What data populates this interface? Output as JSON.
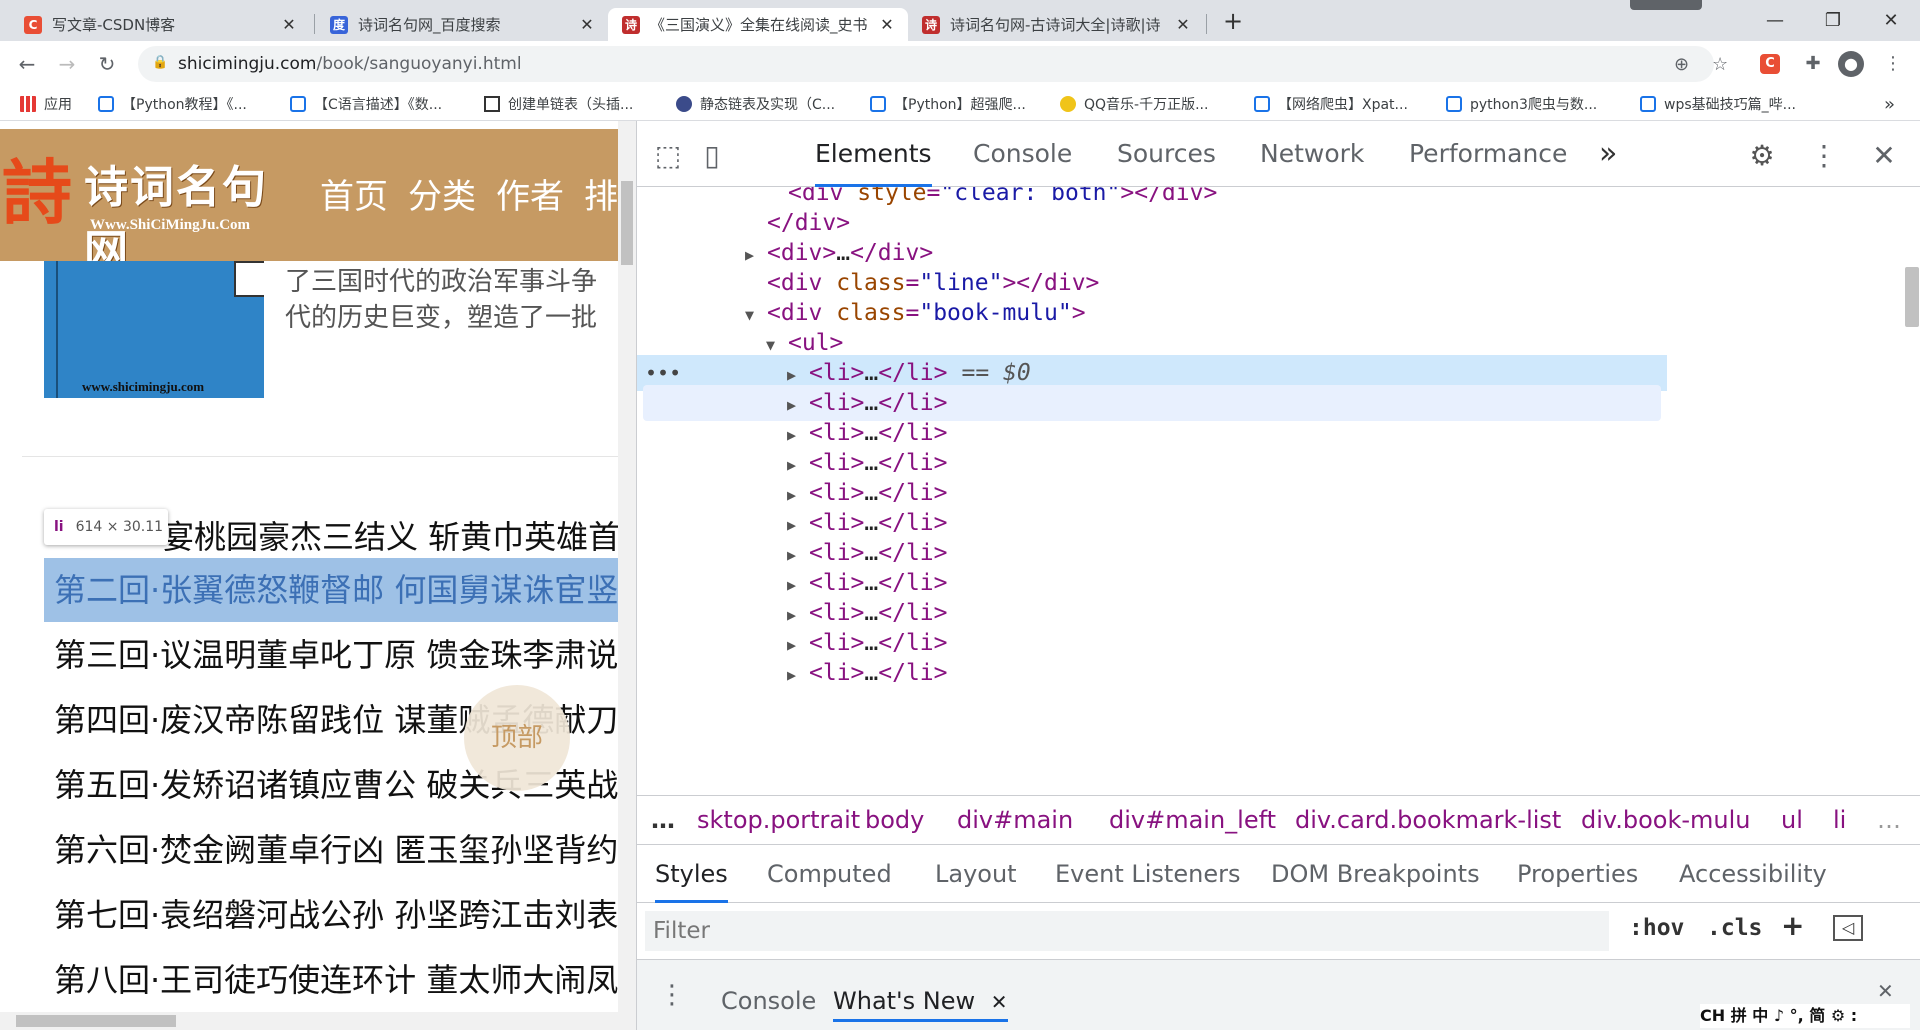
{
  "tabs": [
    {
      "title": "写文章-CSDN博客",
      "favicon": "csdn-icon",
      "color": "#e94e35",
      "glyph": "C"
    },
    {
      "title": "诗词名句网_百度搜索",
      "favicon": "baidu-icon",
      "color": "#3864d9",
      "glyph": "度"
    },
    {
      "title": "《三国演义》全集在线阅读_史书",
      "favicon": "shici-icon",
      "color": "#c02e2e",
      "glyph": "诗"
    },
    {
      "title": "诗词名句网-古诗词大全|诗歌|诗",
      "favicon": "shici-icon",
      "color": "#c02e2e",
      "glyph": "诗"
    }
  ],
  "new_tab": "+",
  "window": {
    "minimize": "—",
    "maximize": "❐",
    "close": "✕"
  },
  "address": {
    "host": "shicimingju.com",
    "path": "/book/sanguoyanyi.html"
  },
  "bookmarks": [
    {
      "label": "应用",
      "color": "#e53935"
    },
    {
      "label": "【Python教程】《...",
      "color": "#1a73e8"
    },
    {
      "label": "【C语言描述】《数...",
      "color": "#1a73e8"
    },
    {
      "label": "创建单链表（头插...",
      "color": "#333333"
    },
    {
      "label": "静态链表及实现（C...",
      "color": "#3b4b8a"
    },
    {
      "label": "【Python】超强爬...",
      "color": "#1a73e8"
    },
    {
      "label": "QQ音乐-千万正版...",
      "color": "#f0c419"
    },
    {
      "label": "【网络爬虫】Xpat...",
      "color": "#1a73e8"
    },
    {
      "label": "python3爬虫与数...",
      "color": "#1a73e8"
    },
    {
      "label": "wps基础技巧篇_哔...",
      "color": "#1a73e8"
    }
  ],
  "bookmarks_more": "»",
  "site": {
    "logo_text": "诗词名句网",
    "logo_url": "Www.ShiCiMingJu.Com",
    "nav": [
      "首页",
      "分类",
      "作者",
      "排"
    ],
    "cover_url": "www.shicimingju.com",
    "intro_lines": [
      "了三国时代的政治军事斗争",
      "代的历史巨变，塑造了一批"
    ],
    "chapters": [
      "宴桃园豪杰三结义 斩黄巾英雄首",
      "第二回·张翼德怒鞭督邮 何国舅谋诛宦竖",
      "第三回·议温明董卓叱丁原 馈金珠李肃说",
      "第四回·废汉帝陈留践位 谋董贼孟德献刀",
      "第五回·发矫诏诸镇应曹公 破关兵三英战",
      "第六回·焚金阙董卓行凶 匿玉玺孙坚背约",
      "第七回·袁绍磐河战公孙 孙坚跨江击刘表",
      "第八回·王司徒巧使连环计 董太师大闹凤"
    ],
    "tooltip": {
      "tag": "li",
      "size": "614 × 30.11"
    },
    "top_button": "顶部"
  },
  "devtools": {
    "tabs": [
      "Elements",
      "Console",
      "Sources",
      "Network",
      "Performance"
    ],
    "more": "»",
    "dom": [
      {
        "indent": 1,
        "tri": "",
        "html": [
          [
            "tag",
            "<div "
          ],
          [
            "attr",
            "style"
          ],
          [
            "tag",
            "="
          ],
          [
            "val",
            "\"clear: both\""
          ],
          [
            "tag",
            "></div>"
          ]
        ]
      },
      {
        "indent": 0,
        "tri": "",
        "html": [
          [
            "tag",
            "</div>"
          ]
        ]
      },
      {
        "indent": 0,
        "tri": "▶",
        "html": [
          [
            "tag",
            "<div>"
          ],
          [
            "txt",
            "…"
          ],
          [
            "tag",
            "</div>"
          ]
        ]
      },
      {
        "indent": 0,
        "tri": "",
        "html": [
          [
            "tag",
            "<div "
          ],
          [
            "attr",
            "class"
          ],
          [
            "tag",
            "="
          ],
          [
            "val",
            "\"line\""
          ],
          [
            "tag",
            "></div>"
          ]
        ]
      },
      {
        "indent": 0,
        "tri": "▼",
        "html": [
          [
            "tag",
            "<div "
          ],
          [
            "attr",
            "class"
          ],
          [
            "tag",
            "="
          ],
          [
            "val",
            "\"book-mulu\""
          ],
          [
            "tag",
            ">"
          ]
        ]
      },
      {
        "indent": 1,
        "tri": "▼",
        "html": [
          [
            "tag",
            "<ul>"
          ]
        ]
      },
      {
        "indent": 2,
        "tri": "▶",
        "html": [
          [
            "tag",
            "<li>"
          ],
          [
            "txt",
            "…"
          ],
          [
            "tag",
            "</li>"
          ]
        ],
        "sel": true
      },
      {
        "indent": 2,
        "tri": "▶",
        "html": [
          [
            "tag",
            "<li>"
          ],
          [
            "txt",
            "…"
          ],
          [
            "tag",
            "</li>"
          ]
        ],
        "hov": true
      },
      {
        "indent": 2,
        "tri": "▶",
        "html": [
          [
            "tag",
            "<li>"
          ],
          [
            "txt",
            "…"
          ],
          [
            "tag",
            "</li>"
          ]
        ]
      },
      {
        "indent": 2,
        "tri": "▶",
        "html": [
          [
            "tag",
            "<li>"
          ],
          [
            "txt",
            "…"
          ],
          [
            "tag",
            "</li>"
          ]
        ]
      },
      {
        "indent": 2,
        "tri": "▶",
        "html": [
          [
            "tag",
            "<li>"
          ],
          [
            "txt",
            "…"
          ],
          [
            "tag",
            "</li>"
          ]
        ]
      },
      {
        "indent": 2,
        "tri": "▶",
        "html": [
          [
            "tag",
            "<li>"
          ],
          [
            "txt",
            "…"
          ],
          [
            "tag",
            "</li>"
          ]
        ]
      },
      {
        "indent": 2,
        "tri": "▶",
        "html": [
          [
            "tag",
            "<li>"
          ],
          [
            "txt",
            "…"
          ],
          [
            "tag",
            "</li>"
          ]
        ]
      },
      {
        "indent": 2,
        "tri": "▶",
        "html": [
          [
            "tag",
            "<li>"
          ],
          [
            "txt",
            "…"
          ],
          [
            "tag",
            "</li>"
          ]
        ]
      },
      {
        "indent": 2,
        "tri": "▶",
        "html": [
          [
            "tag",
            "<li>"
          ],
          [
            "txt",
            "…"
          ],
          [
            "tag",
            "</li>"
          ]
        ]
      },
      {
        "indent": 2,
        "tri": "▶",
        "html": [
          [
            "tag",
            "<li>"
          ],
          [
            "txt",
            "…"
          ],
          [
            "tag",
            "</li>"
          ]
        ]
      },
      {
        "indent": 2,
        "tri": "▶",
        "html": [
          [
            "tag",
            "<li>"
          ],
          [
            "txt",
            "…"
          ],
          [
            "tag",
            "</li>"
          ]
        ]
      }
    ],
    "selected_marker": "== $0",
    "row_dots": "•••",
    "breadcrumbs": [
      "sktop.portrait",
      "body",
      "div#main",
      "div#main_left",
      "div.card.bookmark-list",
      "div.book-mulu",
      "ul",
      "li"
    ],
    "crumb_more": "…",
    "crumb_trail": "…",
    "style_tabs": [
      "Styles",
      "Computed",
      "Layout",
      "Event Listeners",
      "DOM Breakpoints",
      "Properties",
      "Accessibility"
    ],
    "filter_placeholder": "Filter",
    "filter_buttons": [
      ":hov",
      ".cls",
      "+"
    ],
    "drawer_tabs": [
      "Console",
      "What's New"
    ],
    "drawer_close": "✕"
  },
  "ime": "CH 拼 中 ♪ °, 简 ⚙ :"
}
